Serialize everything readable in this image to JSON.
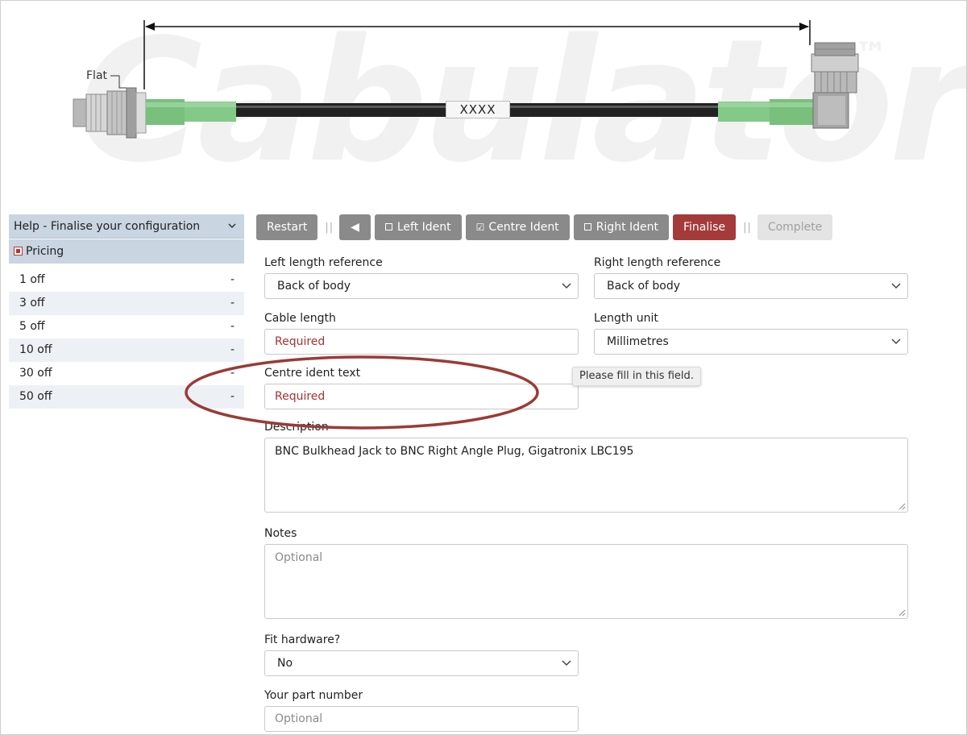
{
  "drawing": {
    "watermark": "Cabulator",
    "trademark": "™",
    "flat_label": "Flat",
    "cable_marker": "XXXX"
  },
  "help": {
    "title": "Help - Finalise your configuration",
    "pricing_label": "Pricing",
    "prices": [
      {
        "qty": "1 off",
        "price": "-"
      },
      {
        "qty": "3 off",
        "price": "-"
      },
      {
        "qty": "5 off",
        "price": "-"
      },
      {
        "qty": "10 off",
        "price": "-"
      },
      {
        "qty": "30 off",
        "price": "-"
      },
      {
        "qty": "50 off",
        "price": "-"
      }
    ]
  },
  "toolbar": {
    "restart": "Restart",
    "separator": "||",
    "back": "◀",
    "left_ident": "Left Ident",
    "centre_ident": "Centre Ident",
    "right_ident": "Right Ident",
    "finalise": "Finalise",
    "complete": "Complete"
  },
  "form": {
    "left_ref_label": "Left length reference",
    "left_ref_value": "Back of body",
    "right_ref_label": "Right length reference",
    "right_ref_value": "Back of body",
    "cable_length_label": "Cable length",
    "cable_length_placeholder": "Required",
    "length_unit_label": "Length unit",
    "length_unit_value": "Millimetres",
    "centre_ident_label": "Centre ident text",
    "centre_ident_placeholder": "Required",
    "tooltip": "Please fill in this field.",
    "description_label": "Description",
    "description_value": "BNC Bulkhead Jack to BNC Right Angle Plug, Gigatronix LBC195",
    "notes_label": "Notes",
    "notes_placeholder": "Optional",
    "fit_hardware_label": "Fit hardware?",
    "fit_hardware_value": "No",
    "part_number_label": "Your part number",
    "part_number_placeholder": "Optional"
  },
  "colors": {
    "accent_red": "#a53a3a",
    "button_grey": "#8a8a8a",
    "panel_blue": "#c9d5e1",
    "required_red": "#a83232",
    "cable_green": "#7cc47f",
    "annotation": "#9a3b36"
  }
}
